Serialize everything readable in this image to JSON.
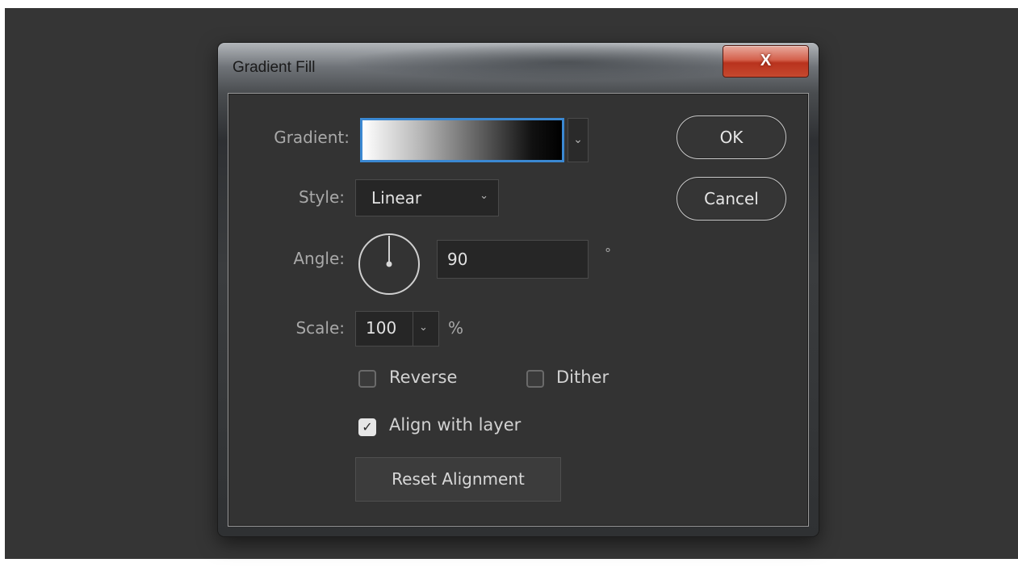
{
  "dialog": {
    "title": "Gradient Fill",
    "close_label": "X"
  },
  "form": {
    "gradient_label": "Gradient:",
    "style_label": "Style:",
    "style_value": "Linear",
    "angle_label": "Angle:",
    "angle_value": "90",
    "angle_unit": "°",
    "scale_label": "Scale:",
    "scale_value": "100",
    "scale_unit": "%",
    "reverse_label": "Reverse",
    "reverse_checked": false,
    "dither_label": "Dither",
    "dither_checked": false,
    "align_label": "Align with layer",
    "align_checked": true,
    "reset_label": "Reset Alignment"
  },
  "actions": {
    "ok_label": "OK",
    "cancel_label": "Cancel"
  },
  "icons": {
    "dropdown": "chevron-down-icon",
    "checkmark": "checkmark-icon",
    "angle_dial": "angle-dial-icon",
    "close": "close-icon"
  },
  "colors": {
    "focus_border": "#3b88d2",
    "close_button": "#c6492f",
    "panel_bg": "#333333"
  }
}
